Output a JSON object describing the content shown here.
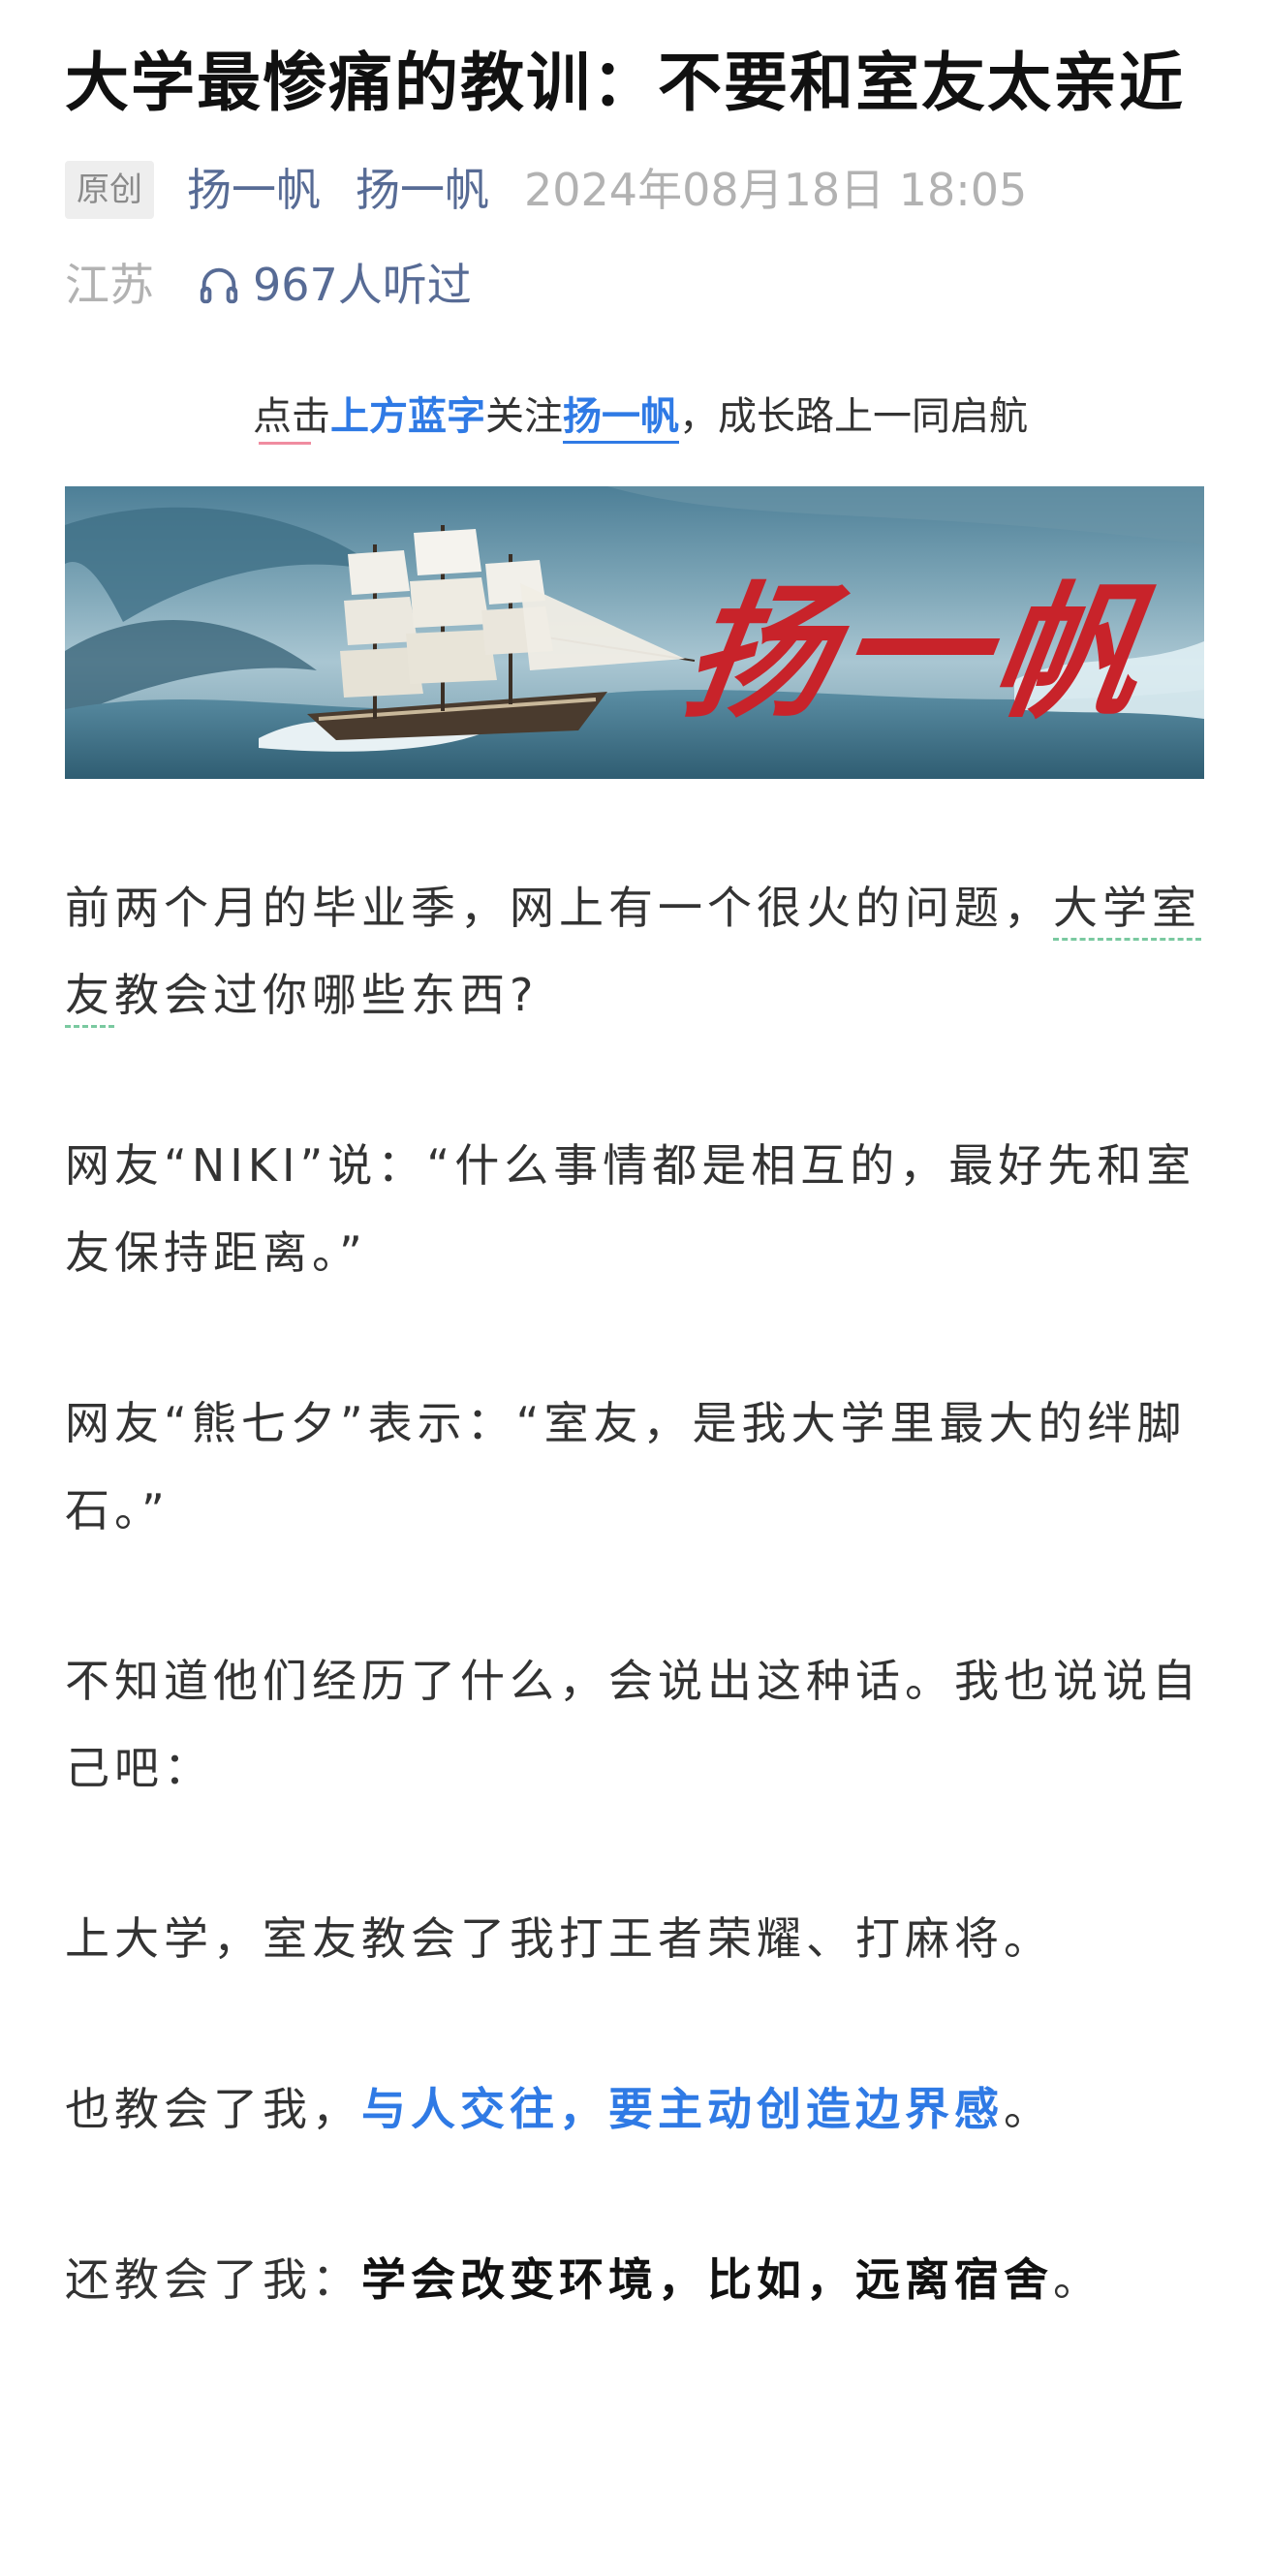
{
  "article": {
    "title": "大学最惨痛的教训：不要和室友太亲近",
    "meta": {
      "badge": "原创",
      "author_1": "扬一帆",
      "author_2": "扬一帆",
      "date": "2024年08月18日 18:05",
      "location": "江苏",
      "listen_count": "967人听过",
      "listen_icon": "headphone-icon"
    },
    "follow": {
      "prefix": "点击",
      "blue_word": "上方蓝字",
      "middle": "关注",
      "account": "扬一帆",
      "suffix": "，成长路上一同启航"
    },
    "banner": {
      "text": "扬一帆"
    },
    "paragraphs": {
      "p1_a": "前两个月的毕业季，网上有一个很火的问题，",
      "p1_link": "大学室友",
      "p1_b": "教会过你哪些东西?",
      "p2": "网友“NIKI”说：“什么事情都是相互的，最好先和室友保持距离。”",
      "p3": "网友“熊七夕”表示：“室友，是我大学里最大的绊脚石。”",
      "p4": "不知道他们经历了什么，会说出这种话。我也说说自己吧：",
      "p5": "上大学，室友教会了我打王者荣耀、打麻将。",
      "p6_a": "也教会了我，",
      "p6_highlight": "与人交往，要主动创造边界感",
      "p6_b": "。",
      "p7_a": "还教会了我：",
      "p7_bold": "学会改变环境，比如，远离宿舍",
      "p7_b": "。"
    },
    "colors": {
      "link_blue": "#576b95",
      "highlight_blue": "#2f7ae5",
      "meta_gray": "#b2b2b2",
      "banner_red": "#c8232a"
    }
  }
}
